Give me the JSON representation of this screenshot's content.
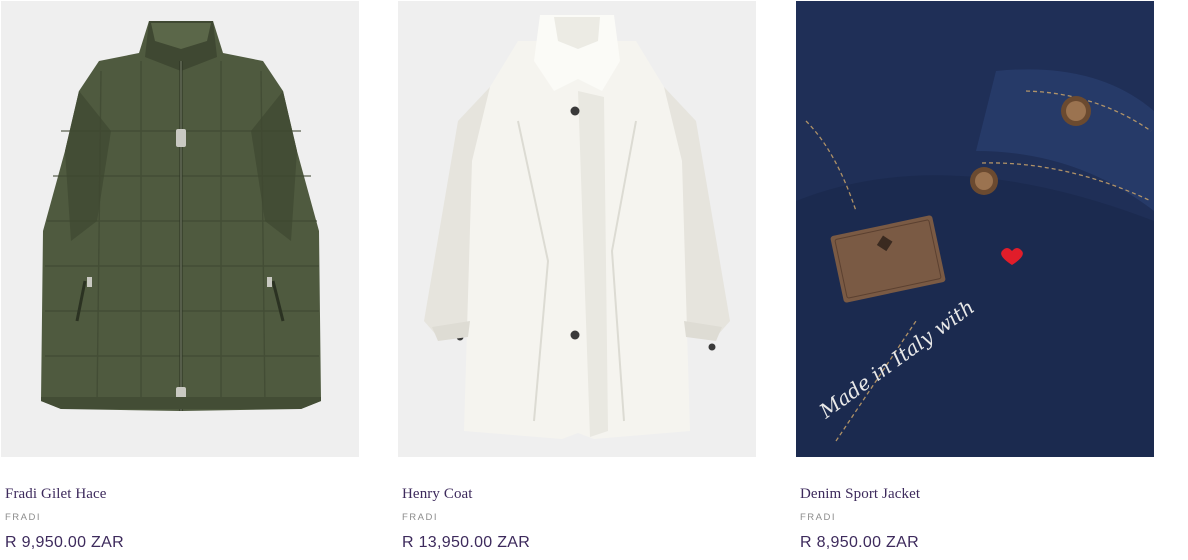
{
  "products": [
    {
      "name": "Fradi Gilet Hace",
      "brand": "FRADI",
      "price": "R 9,950.00 ZAR",
      "image": "olive-quilted-gilet"
    },
    {
      "name": "Henry Coat",
      "brand": "FRADI",
      "price": "R 13,950.00 ZAR",
      "image": "ivory-trench-coat"
    },
    {
      "name": "Denim Sport Jacket",
      "brand": "FRADI",
      "price": "R 8,950.00 ZAR",
      "image": "denim-jacket-detail",
      "embroidery": "Made in Italy with"
    }
  ],
  "colors": {
    "text_primary": "#3d2a5c",
    "text_muted": "#8c8c8c",
    "image_background": "#efefef"
  }
}
